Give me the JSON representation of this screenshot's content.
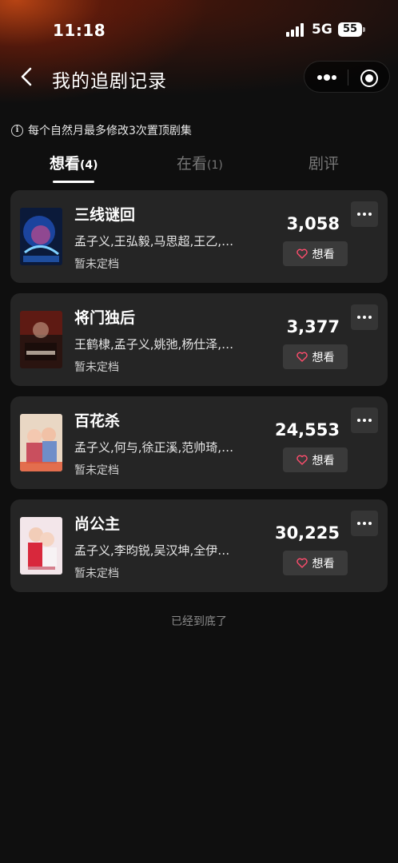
{
  "status_bar": {
    "time": "11:18",
    "network": "5G",
    "battery": "55"
  },
  "nav": {
    "title": "我的追剧记录"
  },
  "notice": {
    "text": "每个自然月最多修改3次置顶剧集",
    "icon": "info-icon"
  },
  "tabs": [
    {
      "label": "想看",
      "count": "(4)",
      "active": true
    },
    {
      "label": "在看",
      "count": "(1)",
      "active": false
    },
    {
      "label": "剧评",
      "count": "",
      "active": false
    }
  ],
  "items": [
    {
      "title": "三线谜回",
      "cast": "孟子义,王弘毅,马思超,王乙,…",
      "status": "暂未定档",
      "count": "3,058",
      "button": "想看"
    },
    {
      "title": "将门独后",
      "cast": "王鹤棣,孟子义,姚弛,杨仕泽,…",
      "status": "暂未定档",
      "count": "3,377",
      "button": "想看"
    },
    {
      "title": "百花杀",
      "cast": "孟子义,何与,徐正溪,范帅琦,…",
      "status": "暂未定档",
      "count": "24,553",
      "button": "想看"
    },
    {
      "title": "尚公主",
      "cast": "孟子义,李昀锐,吴汉坤,全伊…",
      "status": "暂未定档",
      "count": "30,225",
      "button": "想看"
    }
  ],
  "footer": {
    "text": "已经到底了"
  },
  "colors": {
    "background": "#0f0f0f",
    "card": "#252525",
    "button": "#3a3a3a",
    "heart": "#ff4d6d"
  }
}
